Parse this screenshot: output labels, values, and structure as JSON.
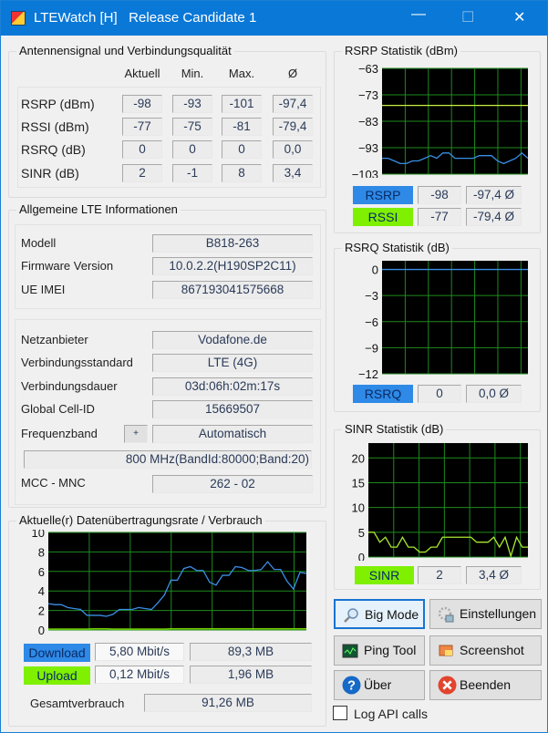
{
  "window": {
    "title": "LTEWatch [H]   Release Candidate 1"
  },
  "signal": {
    "title": "Antennensignal und Verbindungsqualität",
    "headers": [
      "Aktuell",
      "Min.",
      "Max.",
      "Ø"
    ],
    "rows": [
      {
        "label": "RSRP (dBm)",
        "values": [
          "-98",
          "-93",
          "-101",
          "-97,4"
        ]
      },
      {
        "label": "RSSI (dBm)",
        "values": [
          "-77",
          "-75",
          "-81",
          "-79,4"
        ]
      },
      {
        "label": "RSRQ (dB)",
        "values": [
          "0",
          "0",
          "0",
          "0,0"
        ]
      },
      {
        "label": "SINR (dB)",
        "values": [
          "2",
          "-1",
          "8",
          "3,4"
        ]
      }
    ]
  },
  "info": {
    "title": "Allgemeine LTE Informationen",
    "device": [
      {
        "label": "Modell",
        "value": "B818-263"
      },
      {
        "label": "Firmware Version",
        "value": "10.0.2.2(H190SP2C11)"
      },
      {
        "label": "UE IMEI",
        "value": "867193041575668"
      }
    ],
    "network": [
      {
        "label": "Netzanbieter",
        "value": "Vodafone.de"
      },
      {
        "label": "Verbindungsstandard",
        "value": "LTE (4G)"
      },
      {
        "label": "Verbindungsdauer",
        "value": "03d:06h:02m:17s"
      },
      {
        "label": "Global Cell-ID",
        "value": "15669507"
      },
      {
        "label": "Frequenzband",
        "value": "Automatisch"
      }
    ],
    "band_plus": "+",
    "band_detail": "800 MHz(BandId:80000;Band:20)",
    "mcc_label": "MCC - MNC",
    "mcc_value": "262 - 02"
  },
  "traffic": {
    "title": "Aktuelle(r) Datenübertragungsrate / Verbrauch",
    "download_label": "Download",
    "download_rate": "5,80 Mbit/s",
    "download_total": "89,3 MB",
    "upload_label": "Upload",
    "upload_rate": "0,12 Mbit/s",
    "upload_total": "1,96 MB",
    "total_label": "Gesamtverbrauch",
    "total_value": "91,26 MB"
  },
  "rsrp": {
    "title": "RSRP Statistik (dBm)",
    "rsrp_label": "RSRP",
    "rsrp_value": "-98",
    "rsrp_avg": "-97,4 Ø",
    "rssi_label": "RSSI",
    "rssi_value": "-77",
    "rssi_avg": "-79,4 Ø"
  },
  "rsrq": {
    "title": "RSRQ Statistik (dB)",
    "label": "RSRQ",
    "value": "0",
    "avg": "0,0 Ø"
  },
  "sinr": {
    "title": "SINR Statistik (dB)",
    "label": "SINR",
    "value": "2",
    "avg": "3,4 Ø"
  },
  "buttons": {
    "big_mode": "Big Mode",
    "settings": "Einstellungen",
    "ping": "Ping Tool",
    "screenshot": "Screenshot",
    "about": "Über",
    "exit": "Beenden",
    "log_api": "Log API calls"
  },
  "colors": {
    "blue_series": "#3a8ee6",
    "green_series": "#8cf000",
    "grid": "#1e8a1e",
    "rssi_line": "#c8f040"
  },
  "chart_data": [
    {
      "type": "line",
      "ylim": [
        0,
        10
      ],
      "yticks": [
        0,
        2,
        4,
        6,
        8,
        10
      ],
      "series": [
        {
          "name": "Download",
          "color": "#3a8ee6",
          "values": [
            2.7,
            2.6,
            2.6,
            2.3,
            2.2,
            2.1,
            1.5,
            1.5,
            1.5,
            1.4,
            1.6,
            2.1,
            2.1,
            2.1,
            2.3,
            2.2,
            2.1,
            2.8,
            3.6,
            5.1,
            5.1,
            6.3,
            6.5,
            6.1,
            6.1,
            4.9,
            4.6,
            5.6,
            5.6,
            6.5,
            6.4,
            6.1,
            6.1,
            6.2,
            7.0,
            6.2,
            6.2,
            5.0,
            4.2,
            5.9,
            5.8
          ]
        },
        {
          "name": "Upload",
          "color": "#8cf000",
          "values": [
            0,
            0,
            0,
            0,
            0,
            0,
            0,
            0.12,
            0.12,
            0.12,
            0,
            0,
            0,
            0,
            0,
            0,
            0,
            0,
            0,
            0.12,
            0.12,
            0.12,
            0.12,
            0.12,
            0.12,
            0.12,
            0.12,
            0.12,
            0.12,
            0.12,
            0.12,
            0.12,
            0.12,
            0.12,
            0.12,
            0.12,
            0.12,
            0.12,
            0.12,
            0.12,
            0.12
          ]
        }
      ]
    },
    {
      "type": "line",
      "ylim": [
        -103,
        -63
      ],
      "yticks": [
        -63,
        -73,
        -83,
        -93,
        -103
      ],
      "series": [
        {
          "name": "RSRP",
          "color": "#3a8ee6",
          "values": [
            -97,
            -97,
            -98,
            -99,
            -99,
            -98,
            -98,
            -97,
            -96,
            -97,
            -95,
            -95,
            -97,
            -97,
            -97,
            -97,
            -96,
            -96,
            -96,
            -98,
            -99,
            -98,
            -97,
            -95,
            -97
          ]
        },
        {
          "name": "RSSI",
          "color": "#c8f040",
          "values": [
            -77,
            -77,
            -77,
            -77,
            -77,
            -77,
            -77,
            -77,
            -77,
            -77,
            -77,
            -77,
            -77,
            -77,
            -77,
            -77,
            -77,
            -77,
            -77,
            -77,
            -77,
            -77,
            -77,
            -77,
            -77
          ]
        }
      ]
    },
    {
      "type": "line",
      "ylim": [
        -12,
        1
      ],
      "yticks": [
        0,
        -3,
        -6,
        -9,
        -12
      ],
      "series": [
        {
          "name": "RSRQ",
          "color": "#3a8ee6",
          "values": [
            0,
            0,
            0,
            0,
            0,
            0,
            0,
            0,
            0,
            0,
            0,
            0,
            0,
            0,
            0,
            0,
            0,
            0,
            0,
            0
          ]
        }
      ]
    },
    {
      "type": "line",
      "ylim": [
        0,
        23
      ],
      "yticks": [
        0,
        5,
        10,
        15,
        20
      ],
      "series": [
        {
          "name": "SINR",
          "color": "#a8e830",
          "values": [
            5,
            5,
            3,
            4,
            2,
            2,
            4,
            2,
            2,
            1,
            1,
            2,
            2,
            4,
            4,
            4,
            4,
            4,
            4,
            3,
            3,
            3,
            4,
            2,
            4,
            0,
            4,
            2,
            2
          ]
        }
      ]
    }
  ]
}
